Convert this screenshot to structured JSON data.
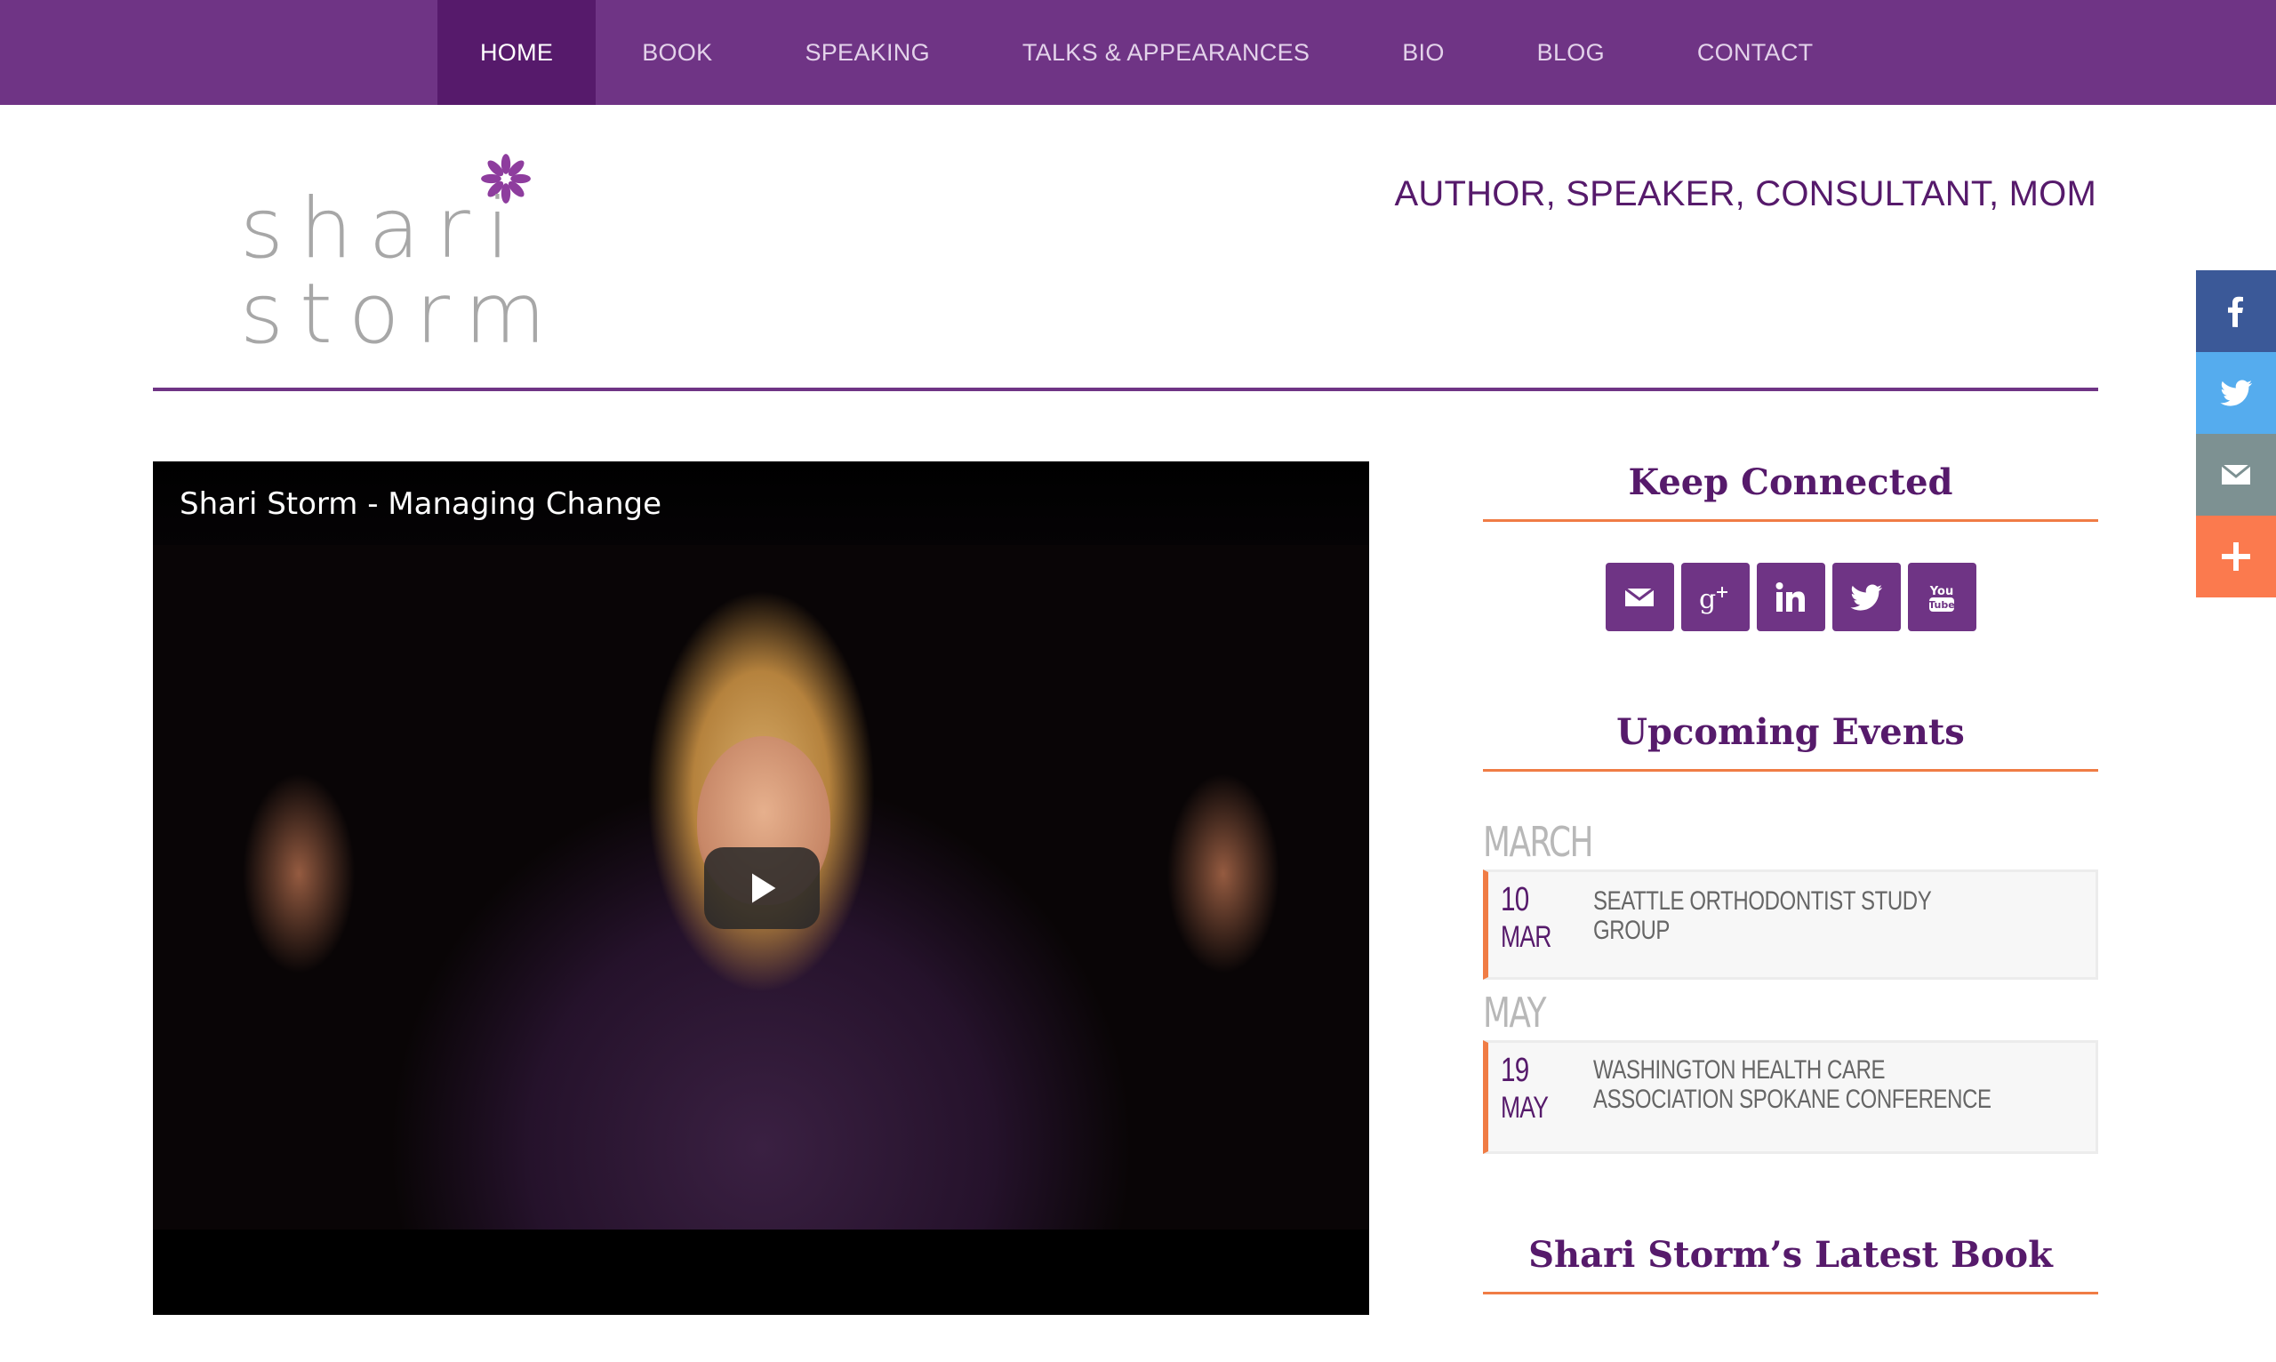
{
  "nav": {
    "items": [
      {
        "label": "HOME",
        "active": true
      },
      {
        "label": "BOOK"
      },
      {
        "label": "SPEAKING"
      },
      {
        "label": "TALKS & APPEARANCES"
      },
      {
        "label": "BIO"
      },
      {
        "label": "BLOG"
      },
      {
        "label": "CONTACT"
      }
    ]
  },
  "header": {
    "logo": {
      "line1": "shari",
      "line2": "storm"
    },
    "tagline": "AUTHOR, SPEAKER, CONSULTANT, MOM"
  },
  "video": {
    "title": "Shari Storm - Managing Change"
  },
  "share": [
    "facebook-icon",
    "twitter-icon",
    "email-icon",
    "plus-icon"
  ],
  "sidebar": {
    "keep_connected": {
      "title": "Keep Connected",
      "icons": [
        "email-icon",
        "google-plus-icon",
        "linkedin-icon",
        "twitter-icon",
        "youtube-icon"
      ]
    },
    "events": {
      "title": "Upcoming Events",
      "groups": [
        {
          "month": "MARCH",
          "items": [
            {
              "day": "10",
              "mon": "MAR",
              "name": "SEATTLE ORTHODONTIST STUDY GROUP"
            }
          ]
        },
        {
          "month": "MAY",
          "items": [
            {
              "day": "19",
              "mon": "MAY",
              "name": "WASHINGTON HEALTH CARE ASSOCIATION SPOKANE CONFERENCE"
            }
          ]
        }
      ]
    },
    "book": {
      "title": "Shari Storm’s Latest Book"
    }
  },
  "colors": {
    "nav_bg": "#6f3485",
    "nav_active": "#561a6b",
    "accent": "#f07c45",
    "brand": "#561a6b"
  }
}
